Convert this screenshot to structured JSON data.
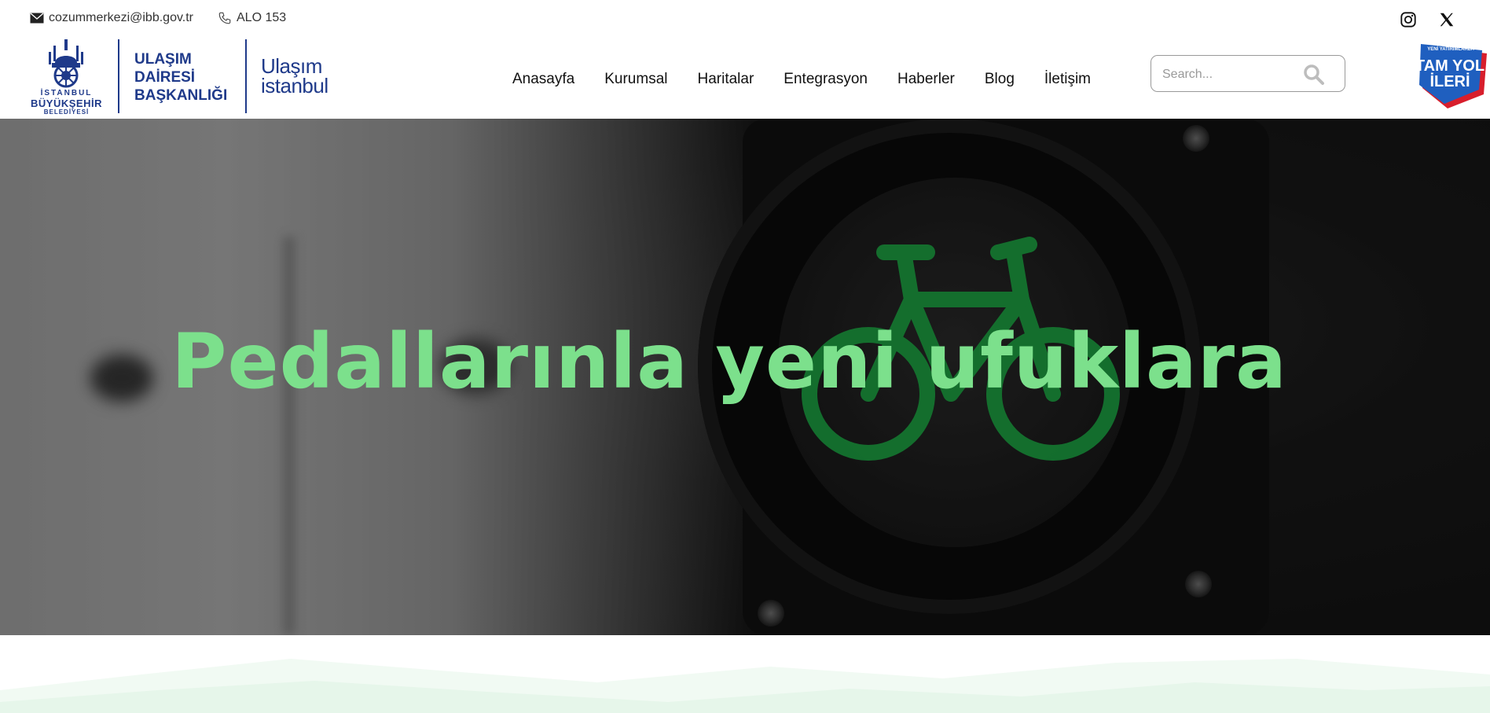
{
  "topbar": {
    "email": "cozummerkezi@ibb.gov.tr",
    "phone": "ALO 153",
    "social": [
      "instagram-icon",
      "x-icon"
    ]
  },
  "header": {
    "ibb_logo": {
      "line1": "İSTANBUL",
      "line2": "BÜYÜKŞEHİR",
      "line3": "BELEDİYESİ"
    },
    "department": [
      "ULAŞIM",
      "DAİRESİ",
      "BAŞKANLIĞI"
    ],
    "brand": [
      "Ulaşım",
      "istanbul"
    ],
    "nav": [
      "Anasayfa",
      "Kurumsal",
      "Haritalar",
      "Entegrasyon",
      "Haberler",
      "Blog",
      "İletişim"
    ],
    "search": {
      "placeholder": "Search...",
      "value": ""
    },
    "campaign": {
      "small": "YENİ YATIRIMLARLA",
      "big1": "TAM YOL",
      "big2": "İLERİ"
    }
  },
  "hero": {
    "title": "Pedallarınla yeni ufuklara"
  },
  "colors": {
    "brand_blue": "#1f3a8a",
    "hero_title": "#7ce08c",
    "wave_green": "#e6f6ea"
  }
}
